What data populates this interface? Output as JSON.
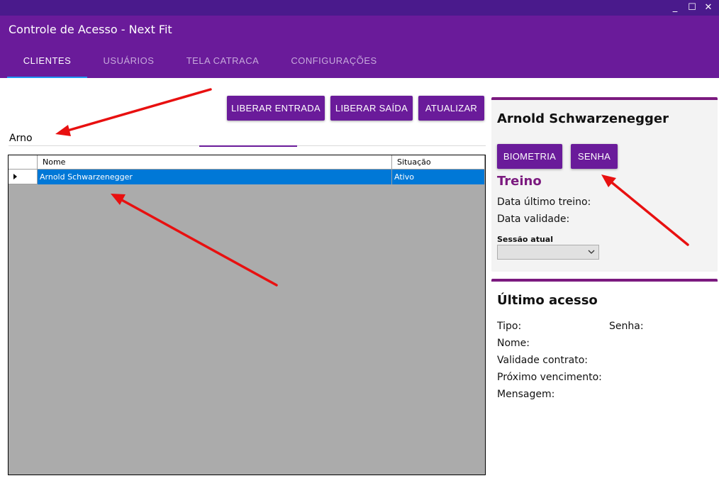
{
  "window": {
    "title": "Controle de Acesso - Next Fit",
    "controls": {
      "minimize": "_",
      "maximize": "☐",
      "close": "✕"
    }
  },
  "tabs": [
    {
      "label": "CLIENTES",
      "active": true
    },
    {
      "label": "USUÁRIOS",
      "active": false
    },
    {
      "label": "TELA CATRACA",
      "active": false
    },
    {
      "label": "CONFIGURAÇÕES",
      "active": false
    }
  ],
  "toolbar": {
    "liberar_entrada": "LIBERAR ENTRADA",
    "liberar_saida": "LIBERAR SAÍDA",
    "atualizar": "ATUALIZAR"
  },
  "search": {
    "value": "Arno"
  },
  "grid": {
    "columns": [
      "Nome",
      "Situação"
    ],
    "rows": [
      {
        "nome": "Arnold Schwarzenegger",
        "situacao": "Ativo",
        "selected": true
      }
    ]
  },
  "client_card": {
    "name": "Arnold Schwarzenegger",
    "biometria_label": "BIOMETRIA",
    "senha_label": "SENHA",
    "treino_title": "Treino",
    "data_ultimo_treino": "Data último treino:",
    "data_validade": "Data validade:",
    "sessao_label": "Sessão atual",
    "sessao_value": ""
  },
  "ultimo_acesso": {
    "title": "Último acesso",
    "tipo": "Tipo:",
    "senha": "Senha:",
    "nome": "Nome:",
    "validade_contrato": "Validade contrato:",
    "proximo_vencimento": "Próximo vencimento:",
    "mensagem": "Mensagem:"
  },
  "colors": {
    "header": "#6a1b9a",
    "titlebar": "#4a1a8c",
    "button": "#6a1b9a",
    "accent": "#7b1a7f",
    "selection": "#0078d7",
    "tab_indicator": "#2196f3",
    "annotation_arrow": "#e81010"
  },
  "icons": {
    "row_pointer": "row-pointer-icon",
    "dropdown": "chevron-down-icon"
  }
}
